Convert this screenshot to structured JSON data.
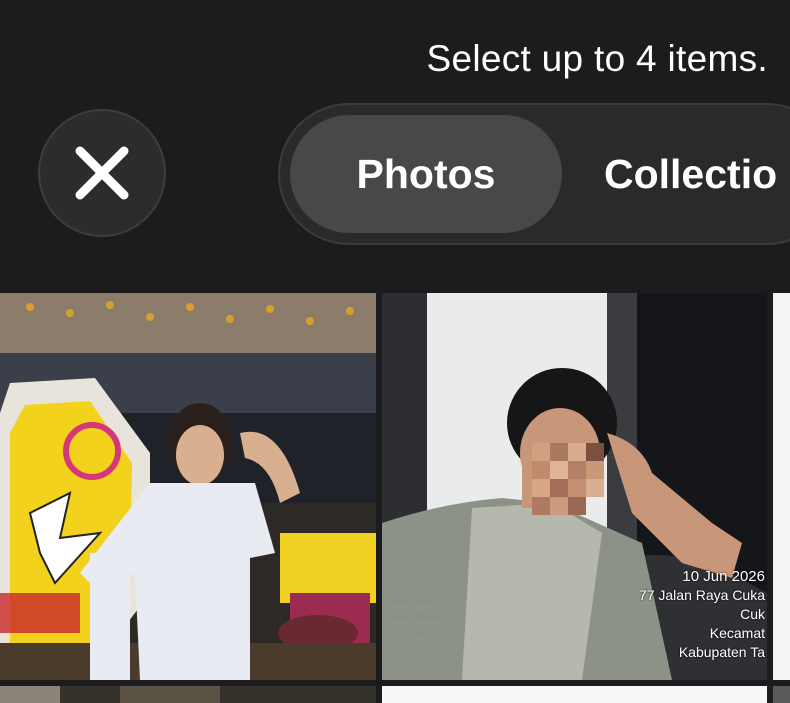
{
  "header": {
    "instruction": "Select up to 4 items.",
    "close_icon": "close-x-icon"
  },
  "tabs": [
    {
      "label": "Photos",
      "selected": true
    },
    {
      "label": "Collectio",
      "selected": false
    }
  ],
  "photos": [
    {
      "kind": "photo",
      "subject": "man posing at amusement park"
    },
    {
      "kind": "photo",
      "subject": "man with blurred face sitting",
      "stamp": {
        "date": "10 Jun 2026",
        "line1": "77 Jalan Raya Cuka",
        "line2": "Cuk",
        "line3": "Kecamat",
        "line4": "Kabupaten Ta"
      },
      "watermark": [
        "Kantor Kabut",
        "Kantor Minteng",
        "Pemerintah Petun"
      ]
    }
  ],
  "colors": {
    "background": "#1c1c1e",
    "button_bg": "#2c2c2e",
    "selected_tab_bg": "#48484a",
    "text": "#ffffff"
  }
}
